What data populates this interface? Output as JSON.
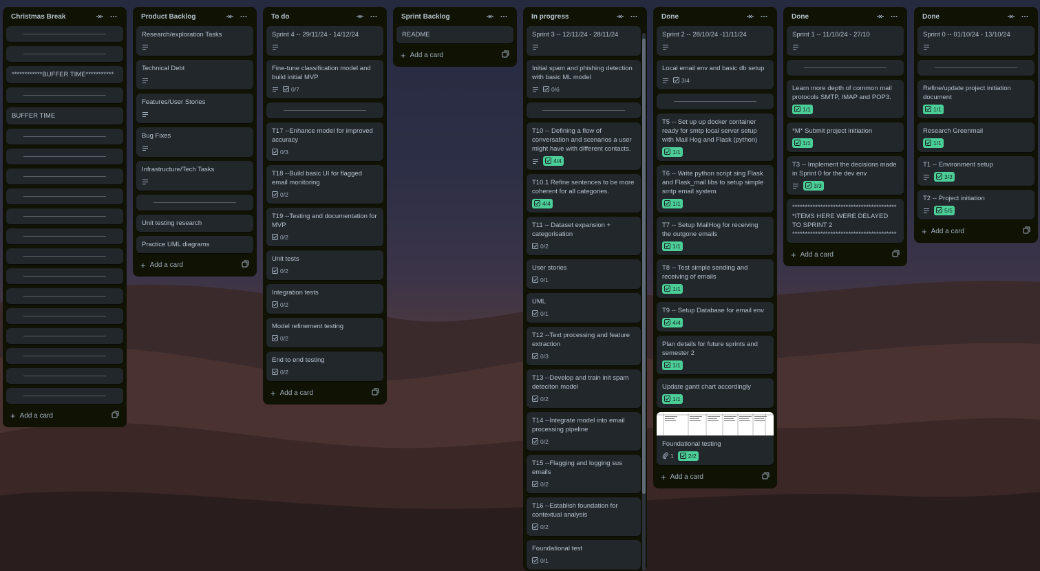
{
  "board": {
    "lists": [
      {
        "id": "christmas",
        "title": "Christmas Break",
        "add_label": "Add a card",
        "cards": [
          {
            "type": "sep"
          },
          {
            "type": "sep"
          },
          {
            "type": "text",
            "title": "************BUFFER TIME***********"
          },
          {
            "type": "sep"
          },
          {
            "type": "text",
            "title": "BUFFER TIME"
          },
          {
            "type": "sep"
          },
          {
            "type": "sep"
          },
          {
            "type": "sep"
          },
          {
            "type": "sep"
          },
          {
            "type": "sep"
          },
          {
            "type": "sep"
          },
          {
            "type": "sep"
          },
          {
            "type": "sep"
          },
          {
            "type": "sep"
          },
          {
            "type": "sep"
          },
          {
            "type": "sep"
          },
          {
            "type": "sep"
          },
          {
            "type": "sep"
          },
          {
            "type": "sep"
          }
        ]
      },
      {
        "id": "backlog",
        "title": "Product Backlog",
        "add_label": "Add a card",
        "cards": [
          {
            "type": "text",
            "title": "Research/exploration Tasks",
            "desc": true
          },
          {
            "type": "text",
            "title": "Technical Debt",
            "desc": true
          },
          {
            "type": "text",
            "title": "Features/User Stories",
            "desc": true
          },
          {
            "type": "text",
            "title": "Bug Fixes",
            "desc": true
          },
          {
            "type": "text",
            "title": "Infrastructure/Tech Tasks",
            "desc": true
          },
          {
            "type": "sep"
          },
          {
            "type": "text",
            "title": "Unit testing research"
          },
          {
            "type": "text",
            "title": "Practice UML diagrams"
          }
        ]
      },
      {
        "id": "todo",
        "title": "To do",
        "add_label": "Add a card",
        "cards": [
          {
            "type": "text",
            "title": "Sprint 4 -- 29/11/24 - 14/12/24",
            "desc": true
          },
          {
            "type": "text",
            "title": "Fine-tune classification model and build initial MVP",
            "desc": true,
            "check": "0/7"
          },
          {
            "type": "sep"
          },
          {
            "type": "text",
            "title": "T17 --Enhance model for improved accuracy",
            "check": "0/3"
          },
          {
            "type": "text",
            "title": "T18 --Build basic UI for flagged email monitoring",
            "check": "0/2"
          },
          {
            "type": "text",
            "title": "T19 --Testing and documentation for MVP",
            "check": "0/2"
          },
          {
            "type": "text",
            "title": "Unit tests",
            "check": "0/2"
          },
          {
            "type": "text",
            "title": "Integration tests",
            "check": "0/2"
          },
          {
            "type": "text",
            "title": "Model refinement testing",
            "check": "0/2"
          },
          {
            "type": "text",
            "title": "End to end testing",
            "check": "0/2"
          }
        ]
      },
      {
        "id": "sprint-backlog",
        "title": "Sprint Backlog",
        "add_label": "Add a card",
        "cards": [
          {
            "type": "text",
            "title": "README"
          }
        ]
      },
      {
        "id": "inprogress",
        "title": "In progress",
        "add_label": "Add a card",
        "scroll": true,
        "cards": [
          {
            "type": "text",
            "title": "Sprint 3 -- 12/11/24 - 28/11/24",
            "desc": true
          },
          {
            "type": "text",
            "title": "Initial spam and phishing detection with basic ML model",
            "desc": true,
            "check": "0/6"
          },
          {
            "type": "sep"
          },
          {
            "type": "text",
            "title": "T10 -- Defining a flow of conversation and scenarios a user might have with different contacts.",
            "desc": true,
            "check": "4/4",
            "done": true
          },
          {
            "type": "text",
            "title": "T10.1 Refine sentences to be more coherent for all categories.",
            "check": "4/4",
            "done": true
          },
          {
            "type": "text",
            "title": "T11 -- Dataset expansion + categorisation",
            "check": "0/2"
          },
          {
            "type": "text",
            "title": "User stories",
            "check": "0/1"
          },
          {
            "type": "text",
            "title": "UML",
            "check": "0/1"
          },
          {
            "type": "text",
            "title": "T12 --Text processing and feature extraction",
            "check": "0/3"
          },
          {
            "type": "text",
            "title": "T13 --Develop and train init spam deteciton model",
            "check": "0/2"
          },
          {
            "type": "text",
            "title": "T14 --Integrate model into email processing pipeline",
            "check": "0/2"
          },
          {
            "type": "text",
            "title": "T15 --Flagging and logging sus emails",
            "check": "0/2"
          },
          {
            "type": "text",
            "title": "T16 --Establish foundation for contextual analysis",
            "check": "0/2"
          },
          {
            "type": "text",
            "title": "Foundational test",
            "check": "0/1"
          }
        ]
      },
      {
        "id": "done-s2",
        "title": "Done",
        "add_label": "Add a card",
        "cards": [
          {
            "type": "text",
            "title": "Sprint 2 -- 28/10/24 -11/11/24",
            "desc": true
          },
          {
            "type": "text",
            "title": "Local email env and basic db setup",
            "desc": true,
            "check": "3/4"
          },
          {
            "type": "sep"
          },
          {
            "type": "text",
            "title": "T5 -- Set up up docker container ready for smtp local server setup with Mail Hog and Flask (python)",
            "check": "1/1",
            "done": true
          },
          {
            "type": "text",
            "title": "T6 -- Write python script sing Flask and Flask_mail libs to setup simple smtp email system",
            "check": "1/1",
            "done": true
          },
          {
            "type": "text",
            "title": "T7 -- Setup MailHog for receiving the outgone emails",
            "check": "1/1",
            "done": true
          },
          {
            "type": "text",
            "title": "T8 -- Test simple sending and receiving of emails",
            "check": "1/1",
            "done": true
          },
          {
            "type": "text",
            "title": "T9 -- Setup Database for email env",
            "check": "4/4",
            "done": true
          },
          {
            "type": "text",
            "title": "Plan details for future sprints and semester 2",
            "check": "1/1",
            "done": true
          },
          {
            "type": "text",
            "title": "Update gantt chart accordingly",
            "check": "1/1",
            "done": true
          },
          {
            "type": "text",
            "title": "Foundational testing",
            "thumb": true,
            "attach": "1",
            "check": "2/2",
            "done": true
          }
        ]
      },
      {
        "id": "done-s1",
        "title": "Done",
        "add_label": "Add a card",
        "cards": [
          {
            "type": "text",
            "title": "Sprint 1 -- 11/10/24 - 27/10",
            "desc": true
          },
          {
            "type": "sep"
          },
          {
            "type": "text",
            "title": "Learn more depth of common mail protocols SMTP, IMAP and POP3.",
            "check": "1/1",
            "done": true
          },
          {
            "type": "text",
            "title": "*M* Submit project initiation",
            "check": "1/1",
            "done": true
          },
          {
            "type": "text",
            "title": "T3 -- Implement the decisions made in Sprint 0 for the dev env",
            "desc": true,
            "check": "3/3",
            "done": true
          },
          {
            "type": "text",
            "title": "*****************************************\n*ITEMS HERE WERE DELAYED TO SPRINT 2\n*****************************************"
          }
        ]
      },
      {
        "id": "done-s0",
        "title": "Done",
        "add_label": "Add a card",
        "cards": [
          {
            "type": "text",
            "title": "Sprint 0 -- 01/10/24 - 13/10/24",
            "desc": true
          },
          {
            "type": "sep"
          },
          {
            "type": "text",
            "title": "Refine/update project initiation document",
            "check": "1/1",
            "done": true
          },
          {
            "type": "text",
            "title": "Research Greenmail",
            "check": "1/1",
            "done": true
          },
          {
            "type": "text",
            "title": "T1 -- Environment setup",
            "desc": true,
            "check": "3/3",
            "done": true
          },
          {
            "type": "text",
            "title": "T2 -- Project initiation",
            "desc": true,
            "check": "5/5",
            "done": true
          }
        ]
      }
    ]
  },
  "colors": {
    "list_bg": "#101204",
    "card_bg": "#22272b",
    "text": "#b6c2cf",
    "checklist_done": "#4bce97"
  },
  "icons": {
    "collapse": "collapse-icon",
    "more": "more-icon",
    "add": "plus-icon",
    "template": "template-icon",
    "description": "description-icon",
    "checklist": "checklist-icon",
    "attachment": "attachment-icon"
  }
}
